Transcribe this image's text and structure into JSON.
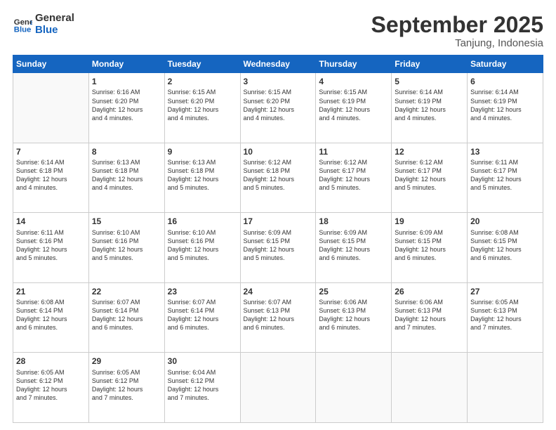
{
  "logo": {
    "line1": "General",
    "line2": "Blue"
  },
  "title": "September 2025",
  "location": "Tanjung, Indonesia",
  "days_header": [
    "Sunday",
    "Monday",
    "Tuesday",
    "Wednesday",
    "Thursday",
    "Friday",
    "Saturday"
  ],
  "weeks": [
    [
      {
        "day": "",
        "info": ""
      },
      {
        "day": "1",
        "info": "Sunrise: 6:16 AM\nSunset: 6:20 PM\nDaylight: 12 hours\nand 4 minutes."
      },
      {
        "day": "2",
        "info": "Sunrise: 6:15 AM\nSunset: 6:20 PM\nDaylight: 12 hours\nand 4 minutes."
      },
      {
        "day": "3",
        "info": "Sunrise: 6:15 AM\nSunset: 6:20 PM\nDaylight: 12 hours\nand 4 minutes."
      },
      {
        "day": "4",
        "info": "Sunrise: 6:15 AM\nSunset: 6:19 PM\nDaylight: 12 hours\nand 4 minutes."
      },
      {
        "day": "5",
        "info": "Sunrise: 6:14 AM\nSunset: 6:19 PM\nDaylight: 12 hours\nand 4 minutes."
      },
      {
        "day": "6",
        "info": "Sunrise: 6:14 AM\nSunset: 6:19 PM\nDaylight: 12 hours\nand 4 minutes."
      }
    ],
    [
      {
        "day": "7",
        "info": "Sunrise: 6:14 AM\nSunset: 6:18 PM\nDaylight: 12 hours\nand 4 minutes."
      },
      {
        "day": "8",
        "info": "Sunrise: 6:13 AM\nSunset: 6:18 PM\nDaylight: 12 hours\nand 4 minutes."
      },
      {
        "day": "9",
        "info": "Sunrise: 6:13 AM\nSunset: 6:18 PM\nDaylight: 12 hours\nand 5 minutes."
      },
      {
        "day": "10",
        "info": "Sunrise: 6:12 AM\nSunset: 6:18 PM\nDaylight: 12 hours\nand 5 minutes."
      },
      {
        "day": "11",
        "info": "Sunrise: 6:12 AM\nSunset: 6:17 PM\nDaylight: 12 hours\nand 5 minutes."
      },
      {
        "day": "12",
        "info": "Sunrise: 6:12 AM\nSunset: 6:17 PM\nDaylight: 12 hours\nand 5 minutes."
      },
      {
        "day": "13",
        "info": "Sunrise: 6:11 AM\nSunset: 6:17 PM\nDaylight: 12 hours\nand 5 minutes."
      }
    ],
    [
      {
        "day": "14",
        "info": "Sunrise: 6:11 AM\nSunset: 6:16 PM\nDaylight: 12 hours\nand 5 minutes."
      },
      {
        "day": "15",
        "info": "Sunrise: 6:10 AM\nSunset: 6:16 PM\nDaylight: 12 hours\nand 5 minutes."
      },
      {
        "day": "16",
        "info": "Sunrise: 6:10 AM\nSunset: 6:16 PM\nDaylight: 12 hours\nand 5 minutes."
      },
      {
        "day": "17",
        "info": "Sunrise: 6:09 AM\nSunset: 6:15 PM\nDaylight: 12 hours\nand 5 minutes."
      },
      {
        "day": "18",
        "info": "Sunrise: 6:09 AM\nSunset: 6:15 PM\nDaylight: 12 hours\nand 6 minutes."
      },
      {
        "day": "19",
        "info": "Sunrise: 6:09 AM\nSunset: 6:15 PM\nDaylight: 12 hours\nand 6 minutes."
      },
      {
        "day": "20",
        "info": "Sunrise: 6:08 AM\nSunset: 6:15 PM\nDaylight: 12 hours\nand 6 minutes."
      }
    ],
    [
      {
        "day": "21",
        "info": "Sunrise: 6:08 AM\nSunset: 6:14 PM\nDaylight: 12 hours\nand 6 minutes."
      },
      {
        "day": "22",
        "info": "Sunrise: 6:07 AM\nSunset: 6:14 PM\nDaylight: 12 hours\nand 6 minutes."
      },
      {
        "day": "23",
        "info": "Sunrise: 6:07 AM\nSunset: 6:14 PM\nDaylight: 12 hours\nand 6 minutes."
      },
      {
        "day": "24",
        "info": "Sunrise: 6:07 AM\nSunset: 6:13 PM\nDaylight: 12 hours\nand 6 minutes."
      },
      {
        "day": "25",
        "info": "Sunrise: 6:06 AM\nSunset: 6:13 PM\nDaylight: 12 hours\nand 6 minutes."
      },
      {
        "day": "26",
        "info": "Sunrise: 6:06 AM\nSunset: 6:13 PM\nDaylight: 12 hours\nand 7 minutes."
      },
      {
        "day": "27",
        "info": "Sunrise: 6:05 AM\nSunset: 6:13 PM\nDaylight: 12 hours\nand 7 minutes."
      }
    ],
    [
      {
        "day": "28",
        "info": "Sunrise: 6:05 AM\nSunset: 6:12 PM\nDaylight: 12 hours\nand 7 minutes."
      },
      {
        "day": "29",
        "info": "Sunrise: 6:05 AM\nSunset: 6:12 PM\nDaylight: 12 hours\nand 7 minutes."
      },
      {
        "day": "30",
        "info": "Sunrise: 6:04 AM\nSunset: 6:12 PM\nDaylight: 12 hours\nand 7 minutes."
      },
      {
        "day": "",
        "info": ""
      },
      {
        "day": "",
        "info": ""
      },
      {
        "day": "",
        "info": ""
      },
      {
        "day": "",
        "info": ""
      }
    ]
  ]
}
